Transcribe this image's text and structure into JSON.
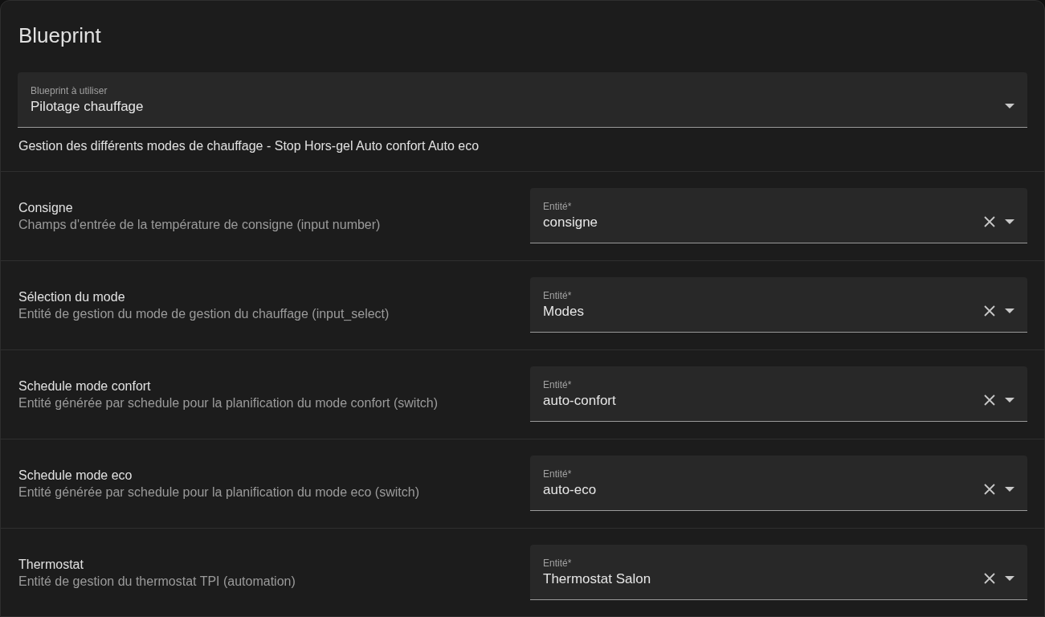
{
  "card": {
    "title": "Blueprint"
  },
  "blueprint_select": {
    "label": "Blueprint à utiliser",
    "value": "Pilotage chauffage"
  },
  "description": "Gestion des différents modes de chauffage - Stop Hors-gel Auto confort Auto eco",
  "inputs": [
    {
      "name": "Consigne",
      "description": "Champs d'entrée de la température de consigne (input number)",
      "field_label": "Entité*",
      "value": "consigne"
    },
    {
      "name": "Sélection du mode",
      "description": "Entité de gestion du mode de gestion du chauffage (input_select)",
      "field_label": "Entité*",
      "value": "Modes"
    },
    {
      "name": "Schedule mode confort",
      "description": "Entité générée par schedule pour la planification du mode confort (switch)",
      "field_label": "Entité*",
      "value": "auto-confort"
    },
    {
      "name": "Schedule mode eco",
      "description": "Entité générée par schedule pour la planification du mode eco (switch)",
      "field_label": "Entité*",
      "value": "auto-eco"
    },
    {
      "name": "Thermostat",
      "description": "Entité de gestion du thermostat TPI (automation)",
      "field_label": "Entité*",
      "value": "Thermostat Salon"
    }
  ]
}
